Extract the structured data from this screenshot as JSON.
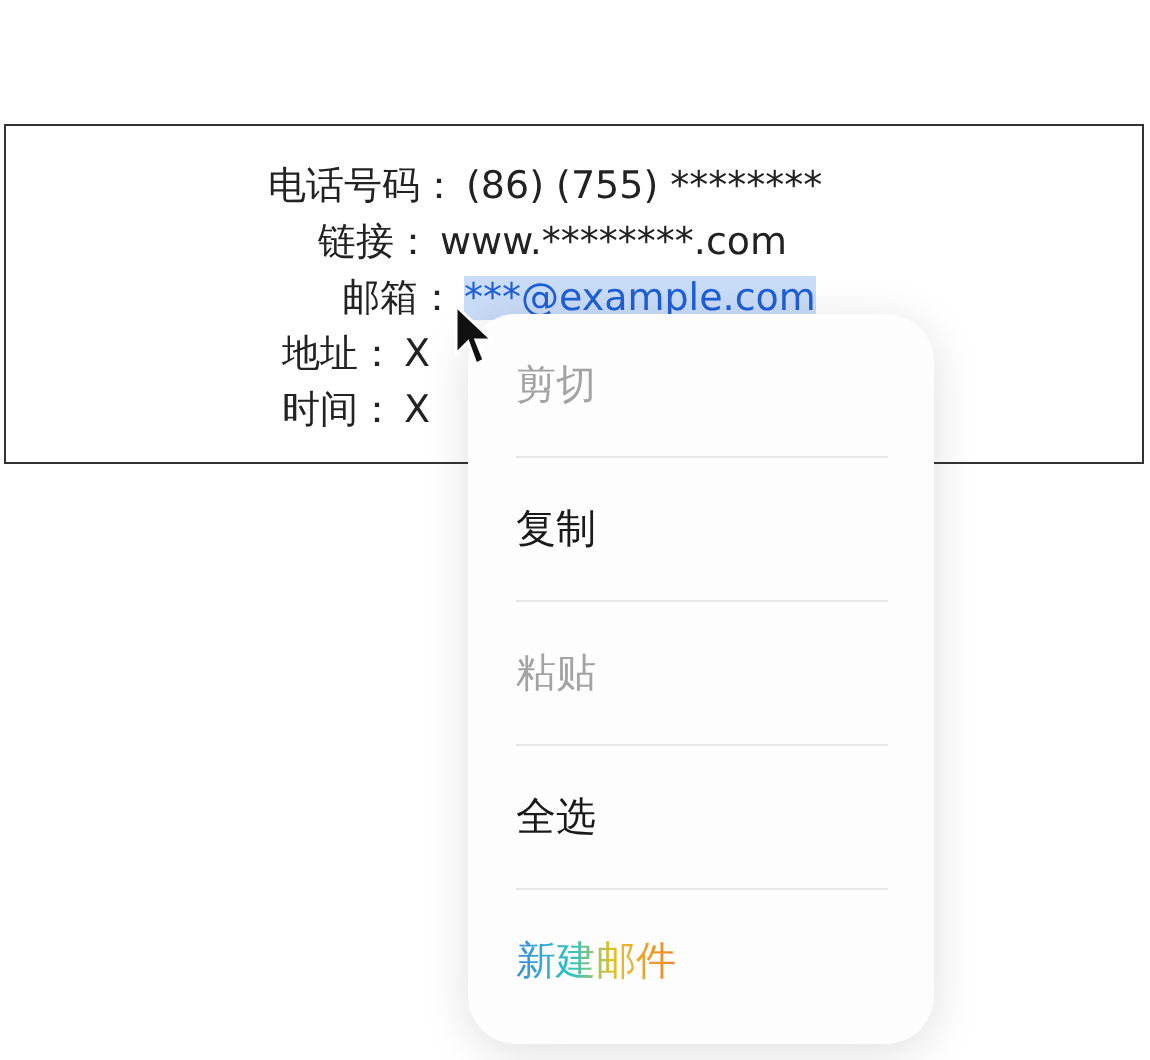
{
  "contact_card": {
    "rows": [
      {
        "label": "电话号码：",
        "value": "(86) (755) ********",
        "kind": "text",
        "selected": false
      },
      {
        "label": "链接：",
        "value": "www.********.com",
        "kind": "text",
        "selected": false
      },
      {
        "label": "邮箱：",
        "value": "***@example.com",
        "kind": "link",
        "selected": true
      },
      {
        "label": "地址：",
        "value": "X",
        "kind": "text",
        "selected": false
      },
      {
        "label": "时间：",
        "value": "X",
        "kind": "text",
        "selected": false
      }
    ]
  },
  "context_menu": {
    "items": [
      {
        "label": "剪切",
        "disabled": true,
        "kind": "plain"
      },
      {
        "label": "复制",
        "disabled": false,
        "kind": "plain"
      },
      {
        "label": "粘贴",
        "disabled": true,
        "kind": "plain"
      },
      {
        "label": "全选",
        "disabled": false,
        "kind": "plain"
      },
      {
        "label": "新建邮件",
        "disabled": false,
        "kind": "gradient"
      }
    ]
  }
}
